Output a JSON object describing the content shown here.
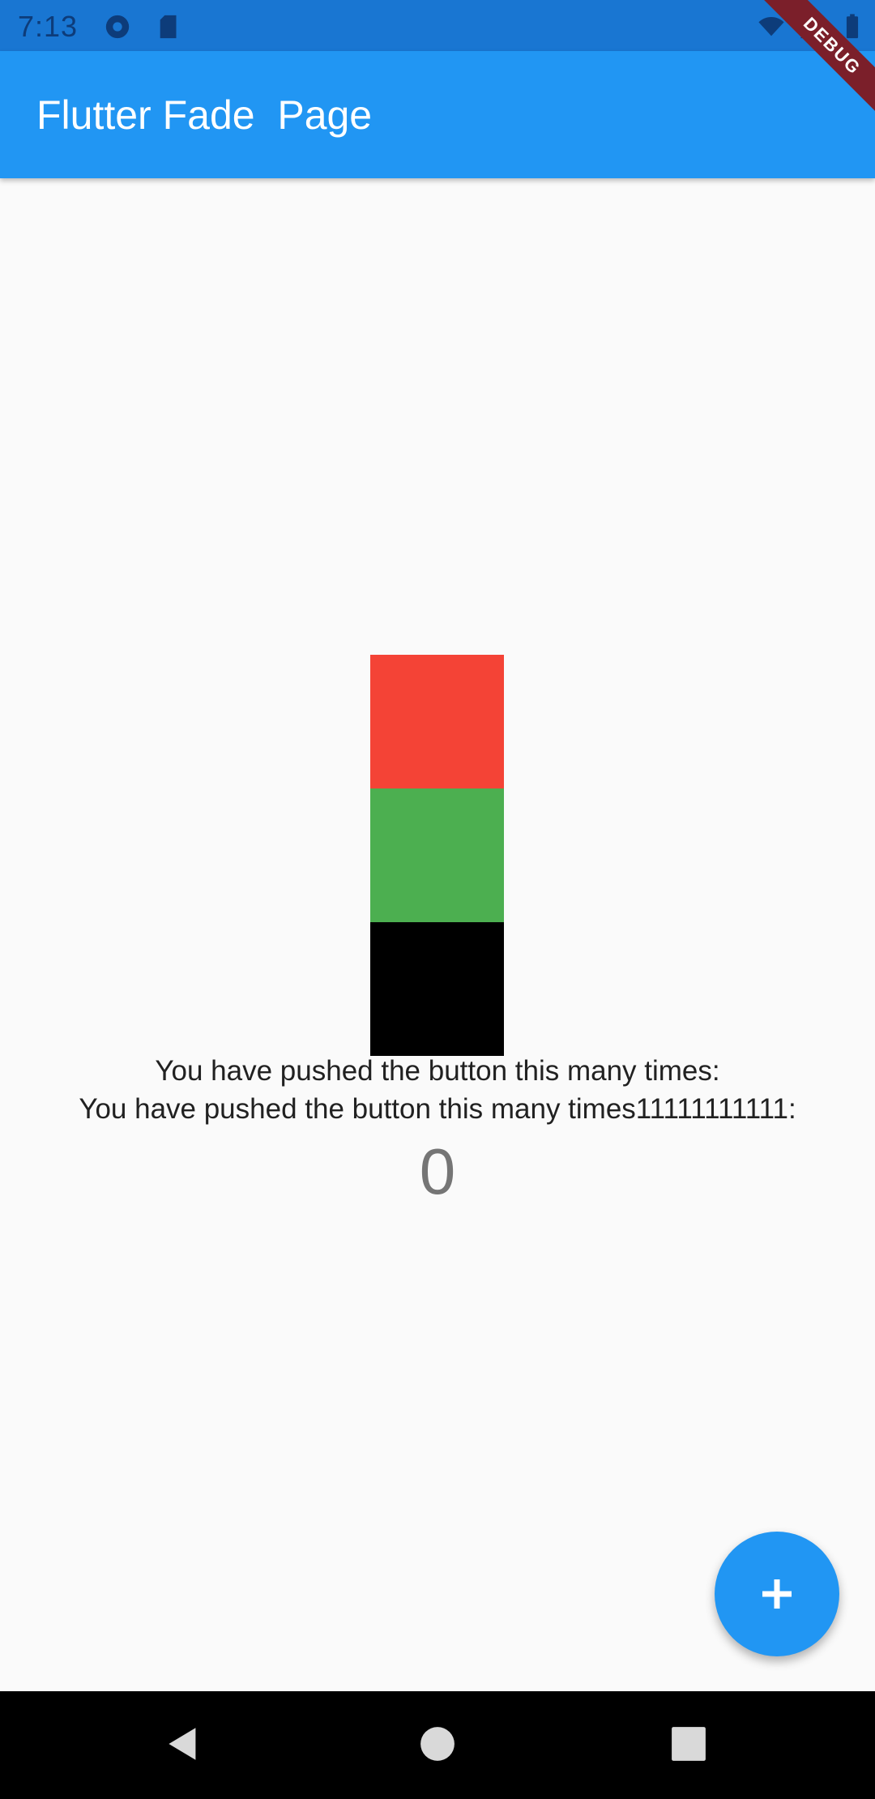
{
  "status_bar": {
    "time": "7:13",
    "icons_left": [
      "settings-icon",
      "sim-card-icon"
    ],
    "icons_right": [
      "wifi-icon",
      "signal-icon",
      "battery-icon"
    ]
  },
  "app_bar": {
    "title": "Flutter Fade  Page"
  },
  "debug_banner": {
    "label": "DEBUG"
  },
  "content": {
    "squares": [
      {
        "name": "red-square",
        "color": "#f44336"
      },
      {
        "name": "green-square",
        "color": "#4caf50"
      },
      {
        "name": "black-square",
        "color": "#000000"
      }
    ],
    "line1": "You have pushed the button this many times:",
    "line2": "You have pushed the button this many times11111111111:",
    "counter": "0"
  },
  "fab": {
    "icon": "plus-icon",
    "color": "#2196f3"
  },
  "nav_bar": {
    "buttons": [
      "back-icon",
      "home-icon",
      "recents-icon"
    ]
  },
  "colors": {
    "primary": "#2196f3",
    "primary_dark": "#1976d2",
    "background": "#fafafa"
  }
}
